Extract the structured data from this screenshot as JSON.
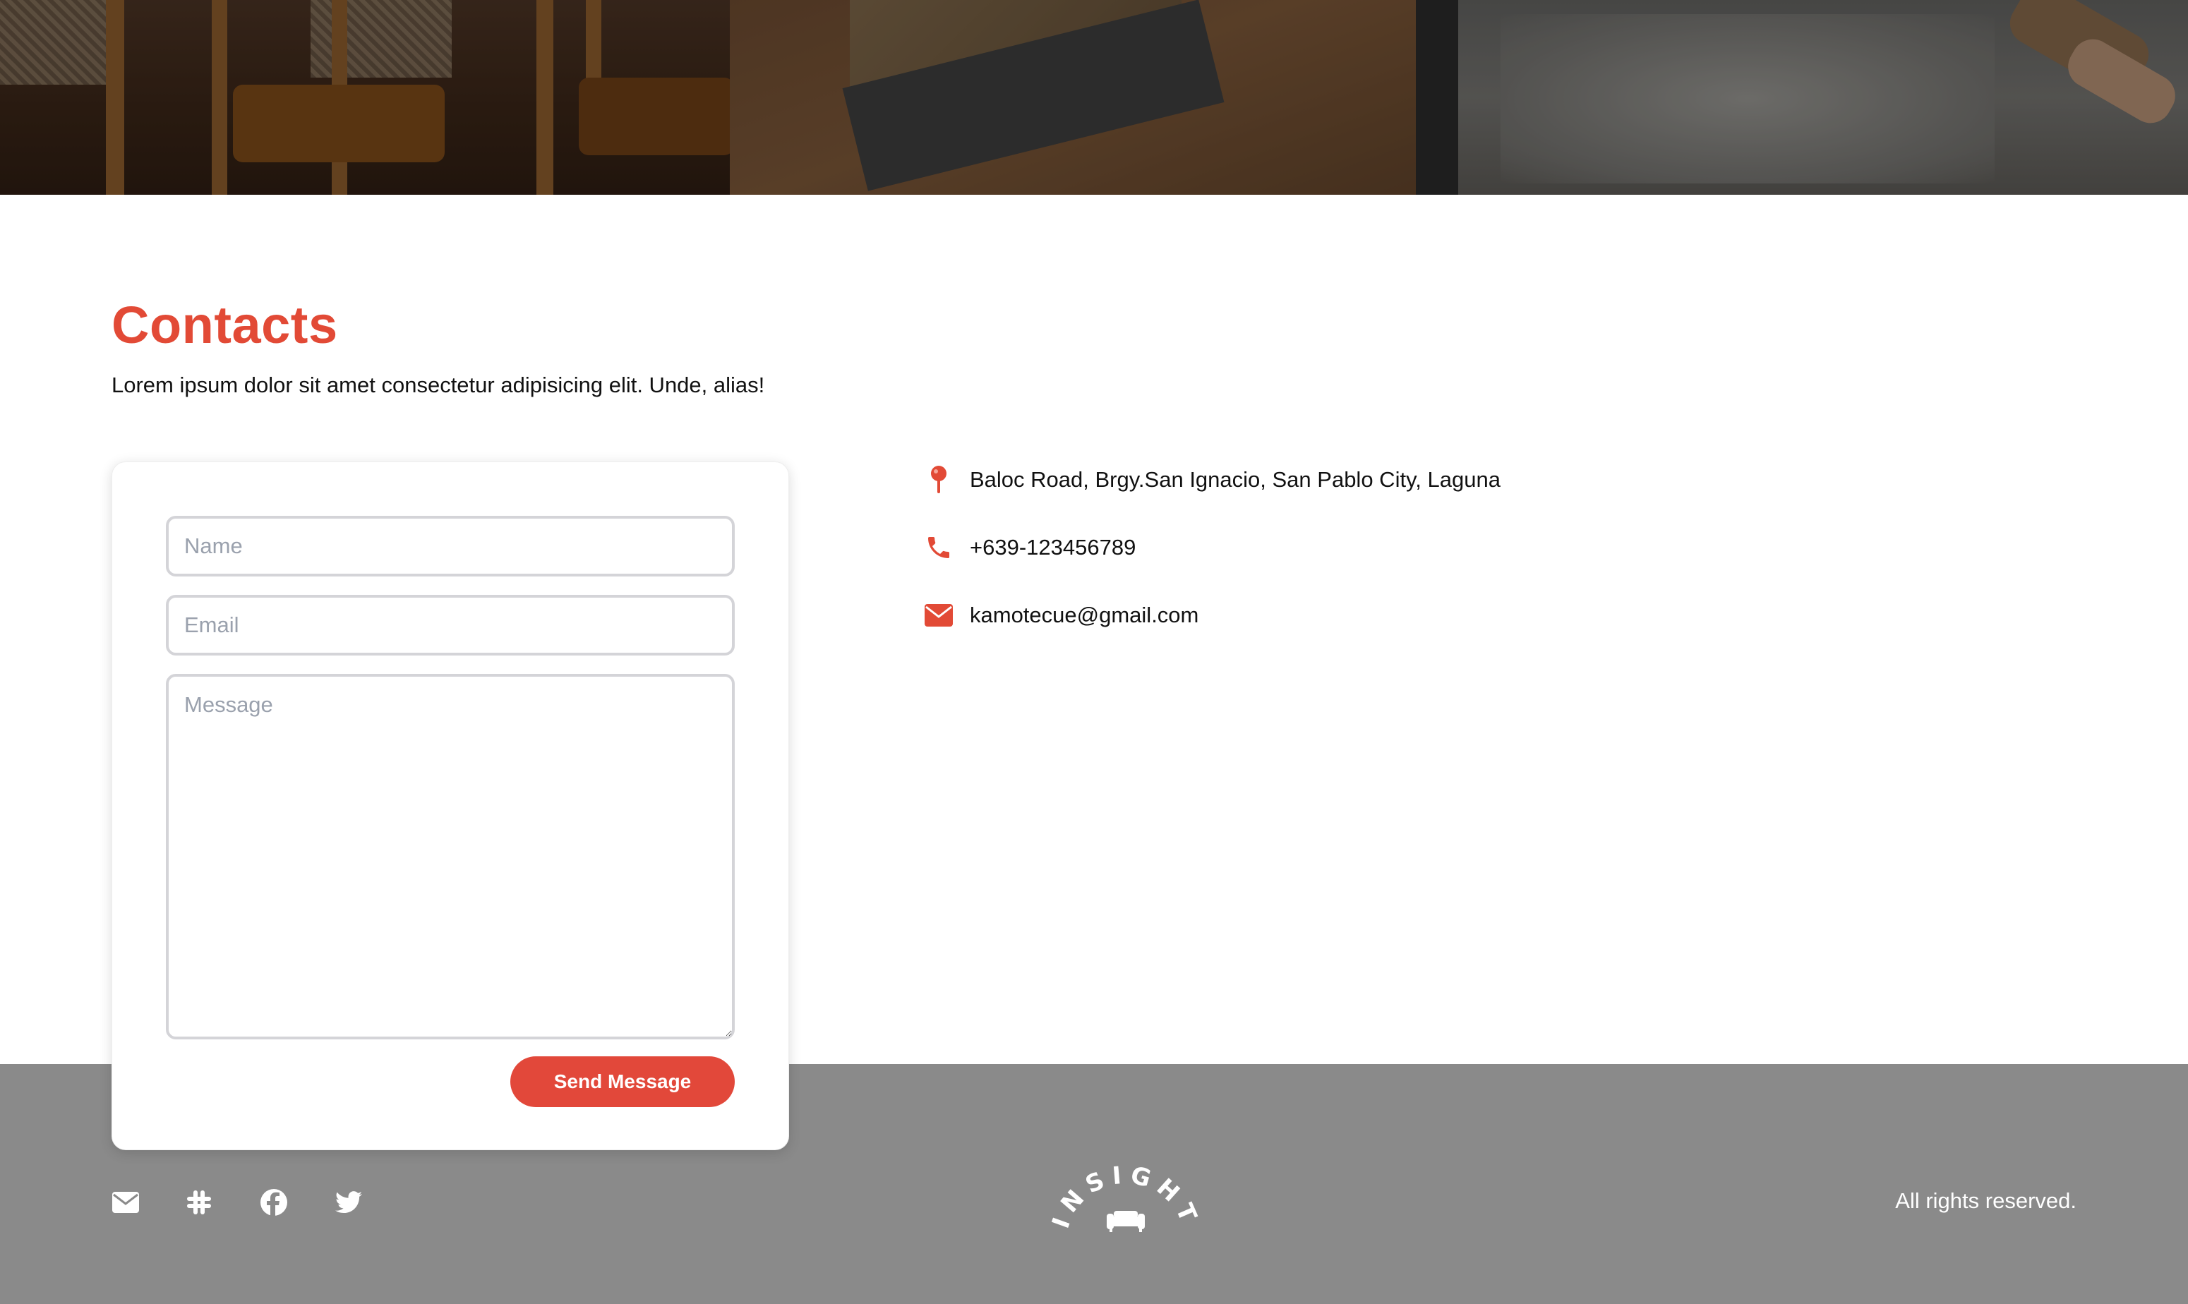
{
  "contacts": {
    "title": "Contacts",
    "description": "Lorem ipsum dolor sit amet consectetur adipisicing elit. Unde, alias!"
  },
  "form": {
    "name_placeholder": "Name",
    "email_placeholder": "Email",
    "message_placeholder": "Message",
    "submit_label": "Send Message"
  },
  "info": {
    "address": "Baloc Road, Brgy.San Ignacio, San Pablo City, Laguna",
    "phone": "+639-123456789",
    "email": "kamotecue@gmail.com"
  },
  "footer": {
    "rights": "All rights reserved.",
    "logo_text": "INSIGHT",
    "social_icons": [
      "envelope-icon",
      "slack-icon",
      "facebook-icon",
      "twitter-icon"
    ]
  },
  "colors": {
    "accent": "#e24a36",
    "footer_bg": "#8a8a8a"
  }
}
